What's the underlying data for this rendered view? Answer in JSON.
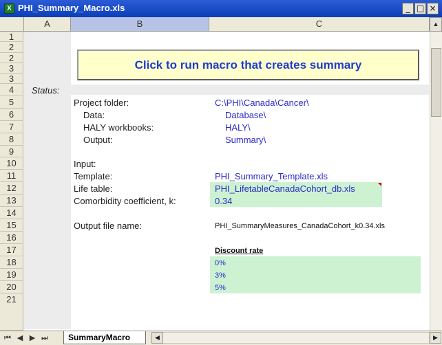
{
  "window": {
    "title": "PHI_Summary_Macro.xls",
    "app_icon": "X",
    "minimize": "_",
    "maximize": "□",
    "close": "×"
  },
  "columns": [
    "A",
    "B",
    "C"
  ],
  "rows": [
    "1",
    "2",
    "3",
    "4",
    "5",
    "6",
    "7",
    "8",
    "9",
    "10",
    "11",
    "12",
    "13",
    "14",
    "15",
    "16",
    "17",
    "18",
    "19",
    "20",
    "21"
  ],
  "macro_button": {
    "label": "Click to run macro that creates summary"
  },
  "cells": {
    "status_label": "Status:",
    "project_folder_label": "Project folder:",
    "project_folder_value": "C:\\PHI\\Canada\\Cancer\\",
    "data_label": "Data:",
    "data_value": "Database\\",
    "haly_label": "HALY workbooks:",
    "haly_value": "HALY\\",
    "output_label": "Output:",
    "output_value": "Summary\\",
    "input_label": "Input:",
    "template_label": "Template:",
    "template_value": "PHI_Summary_Template.xls",
    "lifetable_label": "Life table:",
    "lifetable_value": "PHI_LifetableCanadaCohort_db.xls",
    "comorbidity_label": "Comorbidity coefficient, k:",
    "comorbidity_value": "0.34",
    "output_file_label": "Output file name:",
    "output_file_value": "PHI_SummaryMeasures_CanadaCohort_k0.34.xls",
    "discount_header": "Discount rate",
    "discount_rates": [
      "0%",
      "3%",
      "5%"
    ]
  },
  "sheet_tabs": {
    "active": "SummaryMacro"
  },
  "colors": {
    "accent_blue": "#2b2bc9",
    "input_green": "#ccf2d2",
    "button_yellow": "#ffffcc"
  }
}
